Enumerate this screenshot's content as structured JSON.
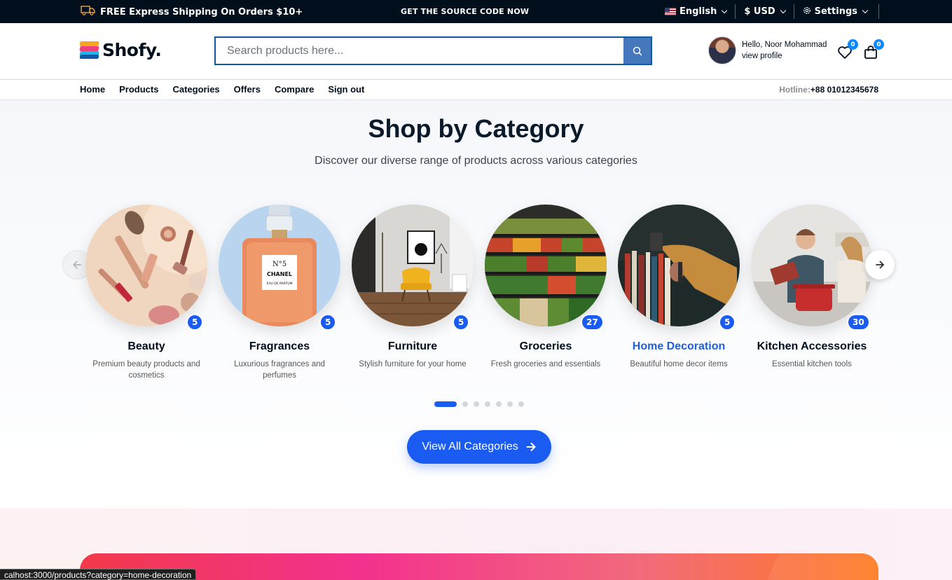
{
  "topbar": {
    "shipping_text": "FREE Express Shipping On Orders $10+",
    "source_code": "GET THE SOURCE CODE NOW",
    "language": "English",
    "currency": "$ USD",
    "settings": "Settings"
  },
  "header": {
    "logo": "Shofy.",
    "search_placeholder": "Search products here...",
    "greeting": "Hello, Noor Mohammad",
    "profile_link": "view profile",
    "wishlist_count": "0",
    "cart_count": "0"
  },
  "nav": {
    "items": [
      "Home",
      "Products",
      "Categories",
      "Offers",
      "Compare",
      "Sign out"
    ],
    "hotline_label": "Hotline:",
    "hotline_number": "+88 01012345678"
  },
  "section": {
    "title": "Shop by Category",
    "subtitle": "Discover our diverse range of products across various categories",
    "categories": [
      {
        "name": "Beauty",
        "count": "5",
        "desc": "Premium beauty products and cosmetics"
      },
      {
        "name": "Fragrances",
        "count": "5",
        "desc": "Luxurious fragrances and perfumes"
      },
      {
        "name": "Furniture",
        "count": "5",
        "desc": "Stylish furniture for your home"
      },
      {
        "name": "Groceries",
        "count": "27",
        "desc": "Fresh groceries and essentials"
      },
      {
        "name": "Home Decoration",
        "count": "5",
        "desc": "Beautiful home decor items"
      },
      {
        "name": "Kitchen Accessories",
        "count": "30",
        "desc": "Essential kitchen tools"
      }
    ],
    "active_category": "Home Decoration",
    "pagination": {
      "total": 7,
      "active": 1
    },
    "cta_label": "View All Categories"
  },
  "perfume_label": {
    "line1": "N°5",
    "line2": "CHANEL",
    "line3": "EAU DE PARFUM"
  },
  "status_url": "calhost:3000/products?category=home-decoration",
  "colors": {
    "accent": "#1a5cf2",
    "topbar": "#010f1c",
    "search_button": "#4577bd",
    "badge": "#0989ff"
  }
}
